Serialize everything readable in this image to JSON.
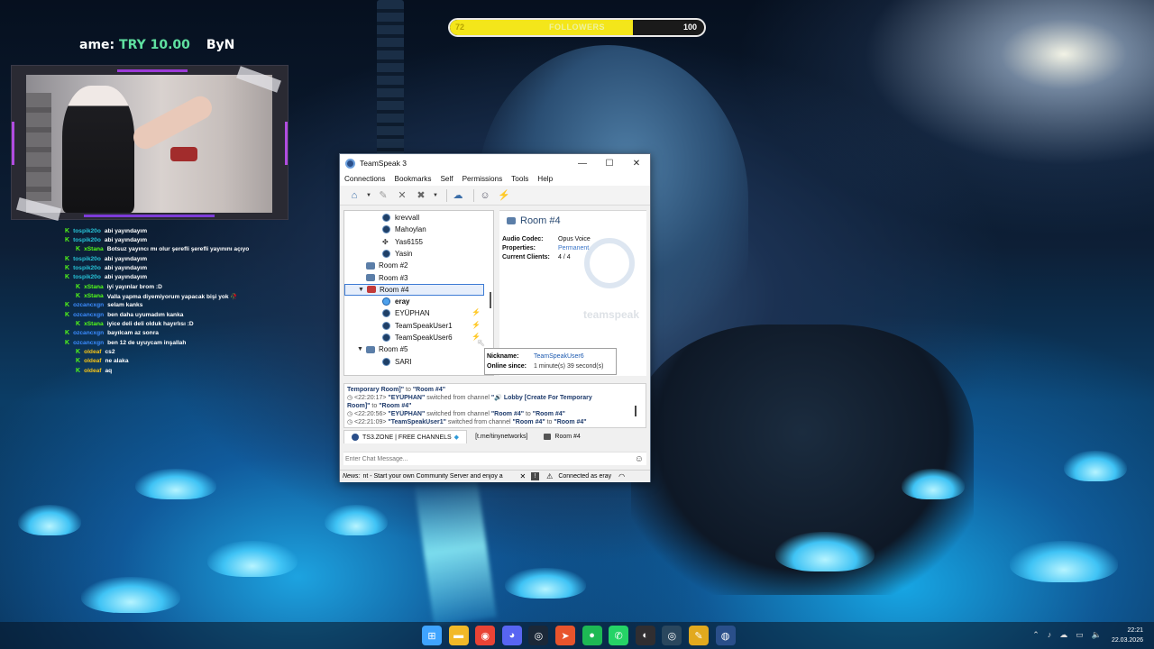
{
  "overlay": {
    "followers": {
      "current": "72",
      "label": "FOLLOWERS",
      "goal": "100",
      "progress": 0.72
    },
    "goal_prefix": "ame: ",
    "goal_value": "TRY 10.00",
    "goal_suffix": "ByN"
  },
  "stream_chat": [
    {
      "user": "tospik20o",
      "color": "#27c2d6",
      "text": "abi yayındayım"
    },
    {
      "user": "tospik20o",
      "color": "#27c2d6",
      "text": "abi yayındayım"
    },
    {
      "user": "xStana",
      "color": "#53fc18",
      "text": "Botsuz yayıncı mı olur şerefli şerefli yayınını açıyo",
      "indent": true
    },
    {
      "user": "tospik20o",
      "color": "#27c2d6",
      "text": "abi yayındayım"
    },
    {
      "user": "tospik20o",
      "color": "#27c2d6",
      "text": "abi yayındayım"
    },
    {
      "user": "tospik20o",
      "color": "#27c2d6",
      "text": "abi yayındayım"
    },
    {
      "user": "xStana",
      "color": "#53fc18",
      "text": "iyi yayınlar brom :D",
      "indent": true
    },
    {
      "user": "xStana",
      "color": "#53fc18",
      "text": "Valla yapma diyemiyorum yapacak bişi yok 🥀",
      "indent": true
    },
    {
      "user": "ozcancxgn",
      "color": "#3b8cff",
      "text": "selam kanks"
    },
    {
      "user": "ozcancxgn",
      "color": "#3b8cff",
      "text": "ben daha uyumadım kanka"
    },
    {
      "user": "xStana",
      "color": "#53fc18",
      "text": "iyice deli deli olduk hayırlısı :D",
      "indent": true
    },
    {
      "user": "ozcancxgn",
      "color": "#3b8cff",
      "text": "bayılcam az sonra"
    },
    {
      "user": "ozcancxgn",
      "color": "#3b8cff",
      "text": "ben 12 de uyuycam inşallah"
    },
    {
      "user": "oldeaf",
      "color": "#f5c518",
      "text": "cs2",
      "indent": true
    },
    {
      "user": "oldeaf",
      "color": "#f5c518",
      "text": "ne alaka",
      "indent": true
    },
    {
      "user": "oldeaf",
      "color": "#f5c518",
      "text": "aq",
      "indent": true
    }
  ],
  "ts": {
    "title": "TeamSpeak 3",
    "window_buttons": {
      "minimize": "—",
      "maximize": "☐",
      "close": "✕"
    },
    "menu": [
      "Connections",
      "Bookmarks",
      "Self",
      "Permissions",
      "Tools",
      "Help"
    ],
    "tree": [
      {
        "kind": "user",
        "label": "krevvall",
        "indent": 2
      },
      {
        "kind": "user",
        "label": "Mahoylan",
        "indent": 2
      },
      {
        "kind": "guest",
        "label": "Yas6155",
        "indent": 2
      },
      {
        "kind": "user",
        "label": "Yasin",
        "indent": 2
      },
      {
        "kind": "channel",
        "label": "Room #2",
        "indent": 1
      },
      {
        "kind": "channel",
        "label": "Room #3",
        "indent": 1
      },
      {
        "kind": "channel-open",
        "label": "Room #4",
        "indent": 1,
        "selected": true,
        "red": true
      },
      {
        "kind": "user-talking",
        "label": "eray",
        "indent": 2,
        "bold": true
      },
      {
        "kind": "user",
        "label": "EYÜPHAN",
        "indent": 2,
        "muted": true
      },
      {
        "kind": "user",
        "label": "TeamSpeakUser1",
        "indent": 2,
        "muted": true
      },
      {
        "kind": "user",
        "label": "TeamSpeakUser6",
        "indent": 2,
        "muted": true
      },
      {
        "kind": "channel-open",
        "label": "Room #5",
        "indent": 1
      },
      {
        "kind": "user",
        "label": "SARI",
        "indent": 2
      }
    ],
    "info": {
      "title": "Room #4",
      "rows": [
        {
          "key": "Audio Codec:",
          "value": "Opus Voice",
          "link": false
        },
        {
          "key": "Properties:",
          "value": "Permanent",
          "link": true
        },
        {
          "key": "Current Clients:",
          "value": "4 / 4",
          "link": false
        }
      ],
      "watermark": "teamspeak"
    },
    "tooltip": {
      "nick_key": "Nickname:",
      "nick_value": "TeamSpeakUser6",
      "online_key": "Online since:",
      "online_value": "1 minute(s) 39 second(s)"
    },
    "chatlog": [
      {
        "html": "<b>Temporary Room]\"</b> to <b>\"Room #4\"</b>"
      },
      {
        "html": "◷ &lt;22:20:17&gt; <b>\"EYÜPHAN\"</b> switched from channel <b>\"🔊 Lobby [Create For Temporary</b>"
      },
      {
        "html": "<b>Room]\"</b> to <b>\"Room #4\"</b>"
      },
      {
        "html": "◷ &lt;22:20:56&gt; <b>\"EYÜPHAN\"</b> switched from channel <b>\"Room #4\"</b> to <b>\"Room #4\"</b>"
      },
      {
        "html": "◷ &lt;22:21:09&gt; <b>\"TeamSpeakUser1\"</b> switched from channel <b>\"Room #4\"</b> to <b>\"Room #4\"</b>"
      }
    ],
    "tabs": [
      {
        "label": "TS3.ZONE | FREE CHANNELS",
        "icon": "server",
        "active": true
      },
      {
        "label": "[t.me/tinynetworks]",
        "icon": "none",
        "active": false
      },
      {
        "label": "Room #4",
        "icon": "channel",
        "active": false
      }
    ],
    "chat_placeholder": "Enter Chat Message...",
    "status": {
      "news_label": "News:",
      "news_text": "nt - Start your own Community Server and enjoy a",
      "connected": "Connected as eray"
    }
  },
  "taskbar": {
    "apps": [
      {
        "name": "start-icon",
        "glyph": "⊞",
        "color": "#3fa4ff"
      },
      {
        "name": "file-explorer-icon",
        "glyph": "▬",
        "color": "#f2b928"
      },
      {
        "name": "chrome-icon",
        "glyph": "◉",
        "color": "#e94335"
      },
      {
        "name": "discord-icon",
        "glyph": "◕",
        "color": "#5865f2"
      },
      {
        "name": "steam-icon",
        "glyph": "◎",
        "color": "#1b2838"
      },
      {
        "name": "arrow-app-icon",
        "glyph": "➤",
        "color": "#e8542c"
      },
      {
        "name": "spotify-icon",
        "glyph": "●",
        "color": "#1db954"
      },
      {
        "name": "whatsapp-icon",
        "glyph": "✆",
        "color": "#25d366"
      },
      {
        "name": "obs-icon",
        "glyph": "◐",
        "color": "#302e31"
      },
      {
        "name": "steam-alt-icon",
        "glyph": "◎",
        "color": "#2a475e"
      },
      {
        "name": "editor-icon",
        "glyph": "✎",
        "color": "#e2a91e"
      },
      {
        "name": "teamspeak-icon",
        "glyph": "◍",
        "color": "#2a4f8a"
      }
    ],
    "time": "22:21",
    "date": "22.03.2026"
  }
}
